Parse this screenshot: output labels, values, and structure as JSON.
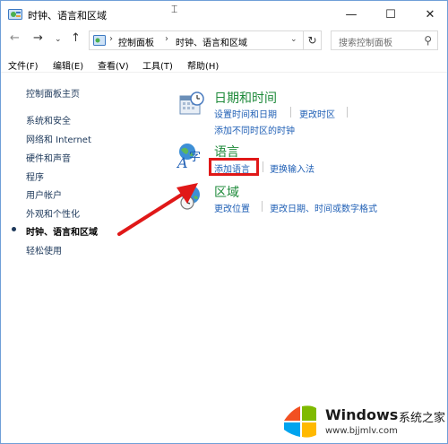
{
  "window": {
    "title": "时钟、语言和区域",
    "minimize_glyph": "—",
    "maximize_glyph": "☐",
    "close_glyph": "✕",
    "cursor_glyph": "⌶"
  },
  "nav": {
    "back_glyph": "←",
    "forward_glyph": "→",
    "dropdown_glyph": "⌄",
    "up_glyph": "↑",
    "breadcrumbs": [
      "控制面板",
      "时钟、语言和区域"
    ],
    "crumb_sep": "›",
    "address_dropdown_glyph": "⌄",
    "refresh_glyph": "↻",
    "search_placeholder": "搜索控制面板",
    "search_glyph": "⚲"
  },
  "menu": {
    "items": [
      "文件(F)",
      "编辑(E)",
      "查看(V)",
      "工具(T)",
      "帮助(H)"
    ]
  },
  "leftnav": {
    "items": [
      "控制面板主页",
      "系统和安全",
      "网络和 Internet",
      "硬件和声音",
      "程序",
      "用户帐户",
      "外观和个性化",
      "时钟、语言和区域",
      "轻松使用"
    ],
    "current_index": 7
  },
  "categories": {
    "datetime": {
      "title": "日期和时间",
      "links": [
        "设置时间和日期",
        "更改时区",
        "添加不同时区的时钟"
      ]
    },
    "language": {
      "title": "语言",
      "links": [
        "添加语言",
        "更换输入法"
      ],
      "highlighted_link": "添加语言"
    },
    "region": {
      "title": "区域",
      "links": [
        "更改位置",
        "更改日期、时间或数字格式"
      ]
    }
  },
  "annotation": {
    "arrow_color": "#e01818",
    "box_color": "#e01818"
  },
  "watermark": {
    "brand": "Windows",
    "text": "系统之家",
    "url": "www.bjjmlv.com"
  },
  "colors": {
    "link": "#1f5fb5",
    "category_title": "#1e8a3a",
    "nav_link": "#1e395b"
  }
}
